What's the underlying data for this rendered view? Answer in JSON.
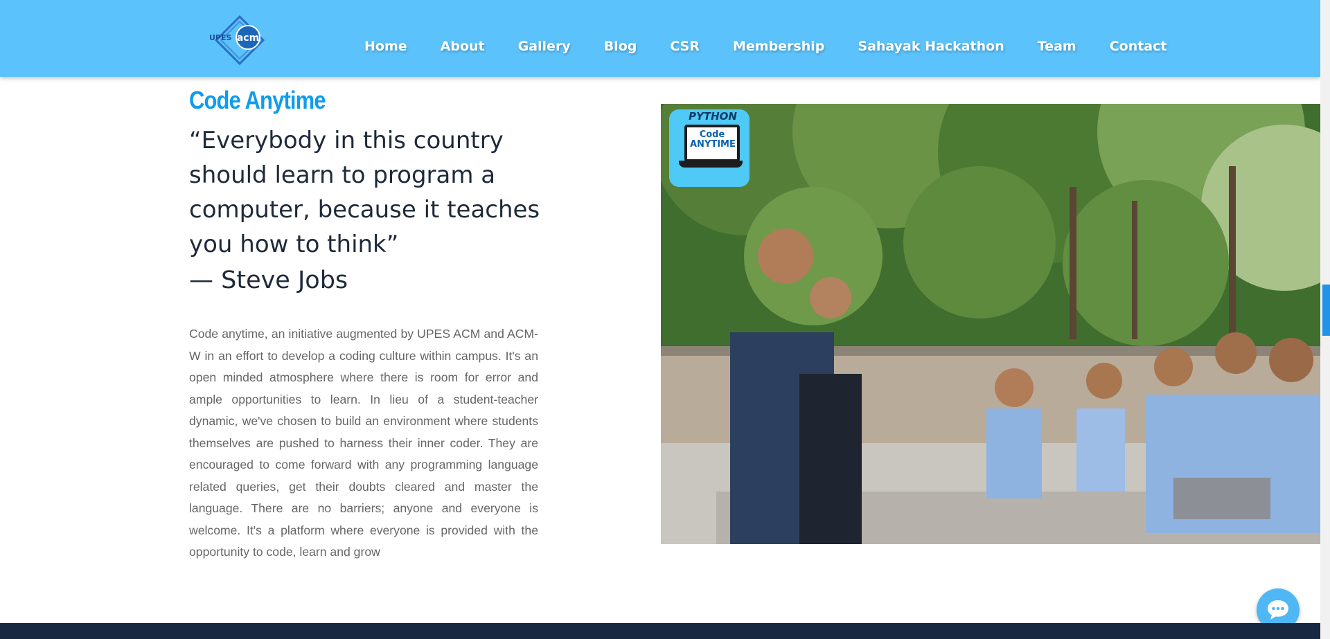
{
  "header": {
    "logo": {
      "text_main": "acm",
      "text_left": "UPES",
      "icon": "acm-logo"
    },
    "nav": [
      "Home",
      "About",
      "Gallery",
      "Blog",
      "CSR",
      "Membership",
      "Sahayak Hackathon",
      "Team",
      "Contact"
    ]
  },
  "content": {
    "title": "Code Anytime",
    "quote_lines": [
      "“Everybody in this country",
      "should learn to program a",
      "computer, because it teaches",
      "you how to think”"
    ],
    "author": "— Steve Jobs",
    "description": "Code anytime, an initiative augmented by UPES ACM and ACM-W in an effort to develop a coding culture within campus. It's an open minded atmosphere where there is room for error and ample opportunities to learn. In lieu of a student-teacher dynamic, we've chosen to build an environment where students themselves are pushed to harness their inner coder. They are encouraged to come forward with any programming language related queries, get their doubts cleared and master the language. There are no barriers; anyone and everyone is welcome. It's a platform where everyone is provided with the opportunity to code, learn and grow"
  },
  "photo": {
    "badge": {
      "top_text": "PYTHON",
      "code_text": "Code",
      "anytime_text": "ANYTIME"
    }
  },
  "colors": {
    "header_bg": "#5bc2fc",
    "title": "#0f9cee",
    "footer_bg": "#172840",
    "scroll_thumb": "#2193e8"
  },
  "icons": {
    "chat": "chat-bubble-icon"
  }
}
